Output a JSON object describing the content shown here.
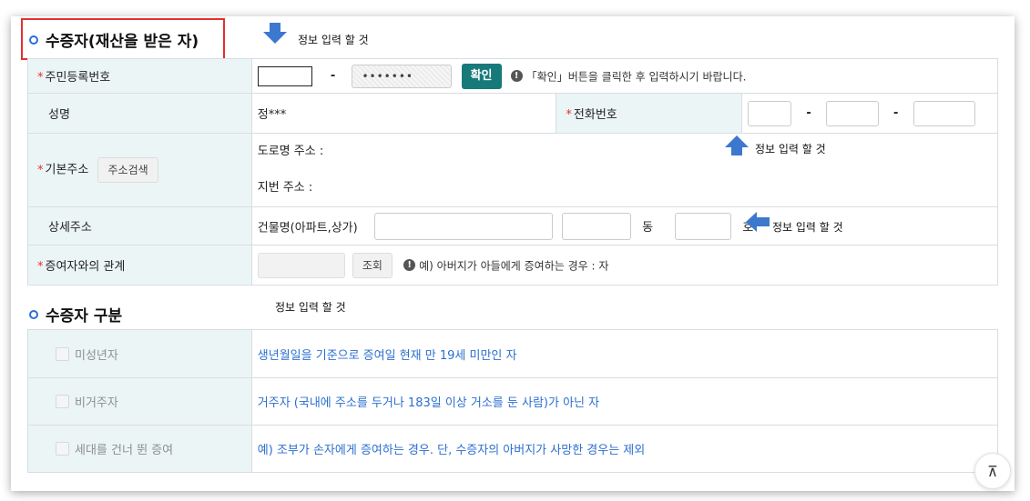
{
  "section1": {
    "title": "수증자(재산을 받은 자)",
    "note_top": "정보 입력 할 것",
    "note_phone": "정보 입력 할 것",
    "note_detail": "정보 입력 할 것",
    "rrn": {
      "label": "주민등록번호",
      "dash": "-",
      "masked_value": "•••••••",
      "confirm_button": "확인",
      "hint": "「확인」버튼을 클릭한 후 입력하시기 바랍니다."
    },
    "name": {
      "label": "성명",
      "value": "정***"
    },
    "phone": {
      "label": "전화번호",
      "dash1": "-",
      "dash2": "-"
    },
    "address": {
      "label": "기본주소",
      "search_button": "주소검색",
      "road_label": "도로명 주소 :",
      "lot_label": "지번 주소 :"
    },
    "detail": {
      "label": "상세주소",
      "building_label": "건물명(아파트,상가)",
      "dong_label": "동",
      "ho_label": "호"
    },
    "relation": {
      "label": "증여자와의 관계",
      "lookup_button": "조회",
      "hint": "예) 아버지가 아들에게 증여하는 경우 : 자"
    },
    "required_mark": "*"
  },
  "section2": {
    "title": "수증자 구분",
    "note": "정보 입력 할 것",
    "rows": [
      {
        "label": "미성년자",
        "desc": "생년월일을 기준으로 증여일 현재 만 19세 미만인 자"
      },
      {
        "label": "비거주자",
        "desc": "거주자 (국내에 주소를 두거나 183일 이상 거소를 둔 사람)가 아닌 자"
      },
      {
        "label": "세대를 건너 뛴 증여",
        "desc": "예) 조부가 손자에게 증여하는 경우. 단, 수증자의 아버지가 사망한 경우는 제외"
      }
    ]
  },
  "info_icon_glyph": "!",
  "scroll_top_glyph": "⊼",
  "colors": {
    "accent_blue": "#2b6fd0",
    "teal_button": "#177a7a",
    "required_red": "#e2302f",
    "header_bg": "#ecf5f5",
    "highlight_red": "#e2302f"
  }
}
